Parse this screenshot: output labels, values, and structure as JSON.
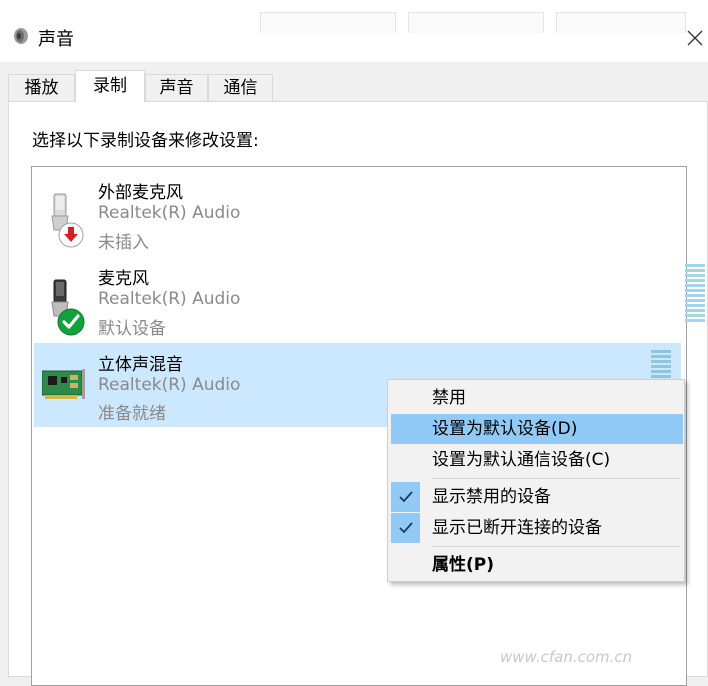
{
  "window": {
    "title": "声音",
    "close_glyph": "✕"
  },
  "tabs": [
    {
      "label": "播放"
    },
    {
      "label": "录制"
    },
    {
      "label": "声音"
    },
    {
      "label": "通信"
    }
  ],
  "prompt": "选择以下录制设备来修改设置:",
  "devices": [
    {
      "name": "外部麦克风",
      "driver": "Realtek(R) Audio",
      "status": "未插入",
      "icon": "microphone-unplugged-icon"
    },
    {
      "name": "麦克风",
      "driver": "Realtek(R) Audio",
      "status": "默认设备",
      "icon": "microphone-default-icon"
    },
    {
      "name": "立体声混音",
      "driver": "Realtek(R) Audio",
      "status": "准备就绪",
      "icon": "sound-card-icon"
    }
  ],
  "context_menu": {
    "items": [
      {
        "label": "禁用"
      },
      {
        "label": "设置为默认设备(D)"
      },
      {
        "label": "设置为默认通信设备(C)"
      },
      {
        "label": "显示禁用的设备",
        "checked": true
      },
      {
        "label": "显示已断开连接的设备",
        "checked": true
      },
      {
        "label": "属性(P)"
      }
    ]
  },
  "watermark": "www.cfan.com.cn",
  "colors": {
    "selection": "#cce8ff",
    "menu_highlight": "#91c9f7",
    "meter": "#a3d4e8",
    "default_badge": "#14a03c",
    "unplugged_badge": "#d42020"
  }
}
